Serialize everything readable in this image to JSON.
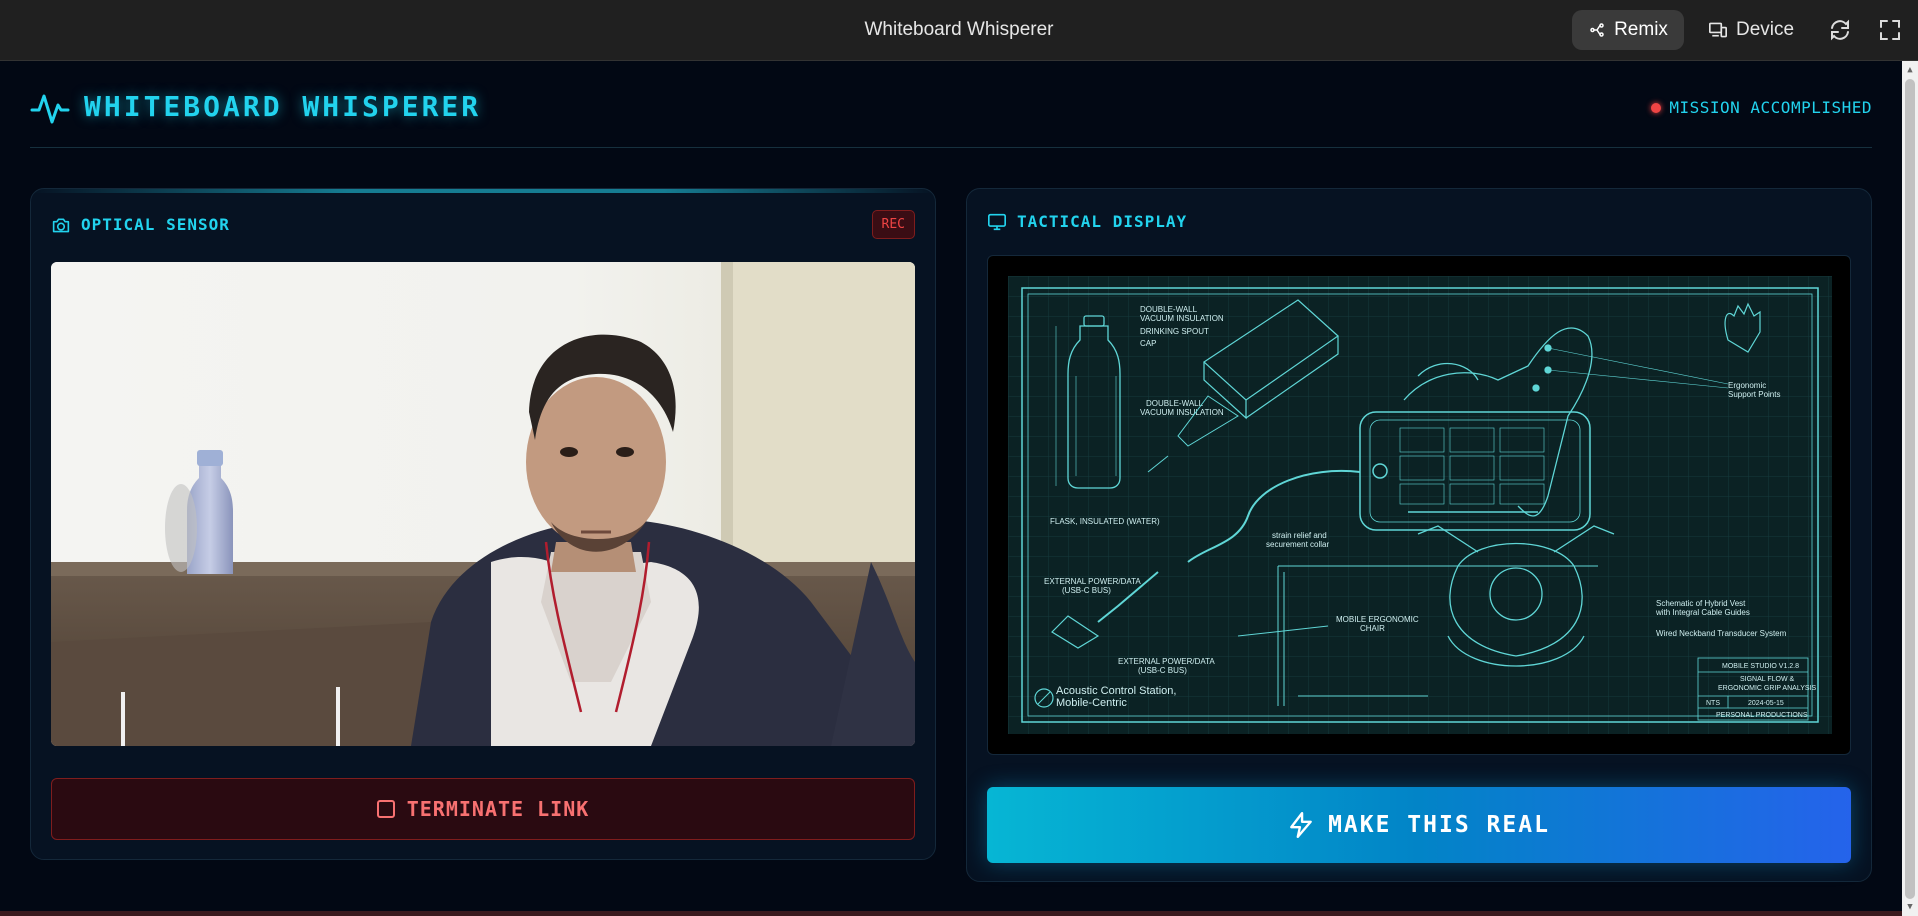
{
  "window": {
    "title": "Whiteboard Whisperer",
    "remix_label": "Remix",
    "device_label": "Device"
  },
  "header": {
    "title": "WHITEBOARD WHISPERER",
    "status": "MISSION ACCOMPLISHED"
  },
  "optical_sensor": {
    "title": "OPTICAL SENSOR",
    "badge": "REC",
    "terminate_label": "TERMINATE LINK"
  },
  "tactical_display": {
    "title": "TACTICAL DISPLAY",
    "action_label": "MAKE THIS REAL",
    "blueprint": {
      "labels": {
        "double_wall_1": "DOUBLE-WALL",
        "vacuum_1": "VACUUM INSULATION",
        "drinking_spout": "DRINKING SPOUT",
        "cap": "CAP",
        "double_wall_2": "DOUBLE-WALL",
        "vacuum_2": "VACUUM INSULATION",
        "flask": "FLASK, INSULATED (WATER)",
        "ergonomic": "Ergonomic",
        "support_points": "Support Points",
        "strain_relief": "strain relief and",
        "securement": "securement collar",
        "ext_power_1": "EXTERNAL POWER/DATA",
        "usbc_1": "(USB-C BUS)",
        "mobile_chair_1": "MOBILE ERGONOMIC",
        "mobile_chair_2": "CHAIR",
        "ext_power_2": "EXTERNAL POWER/DATA",
        "usbc_2": "(USB-C BUS)",
        "vest_1": "Schematic of Hybrid Vest",
        "vest_2": "with Integral Cable Guides",
        "neckband": "Wired Neckband Transducer System",
        "station_1": "Acoustic Control Station,",
        "station_2": "Mobile-Centric",
        "tb_project": "MOBILE STUDIO V1.2.8",
        "tb_sheet_1": "SIGNAL FLOW &",
        "tb_sheet_2": "ERGONOMIC GRIP ANALYSIS",
        "tb_scale": "NTS",
        "tb_date": "2024-05-15",
        "tb_client": "PERSONAL PRODUCTIONS"
      }
    }
  },
  "icons": {
    "logo": "activity-pulse-icon",
    "camera": "camera-icon",
    "monitor": "monitor-icon",
    "stop": "stop-square-icon",
    "bolt": "lightning-bolt-icon",
    "remix": "remix-icon",
    "device": "devices-icon",
    "refresh": "refresh-icon",
    "fullscreen": "fullscreen-icon"
  },
  "colors": {
    "accent": "#22d3ee",
    "danger": "#ef4444",
    "background": "#020814",
    "panel": "#061222"
  }
}
